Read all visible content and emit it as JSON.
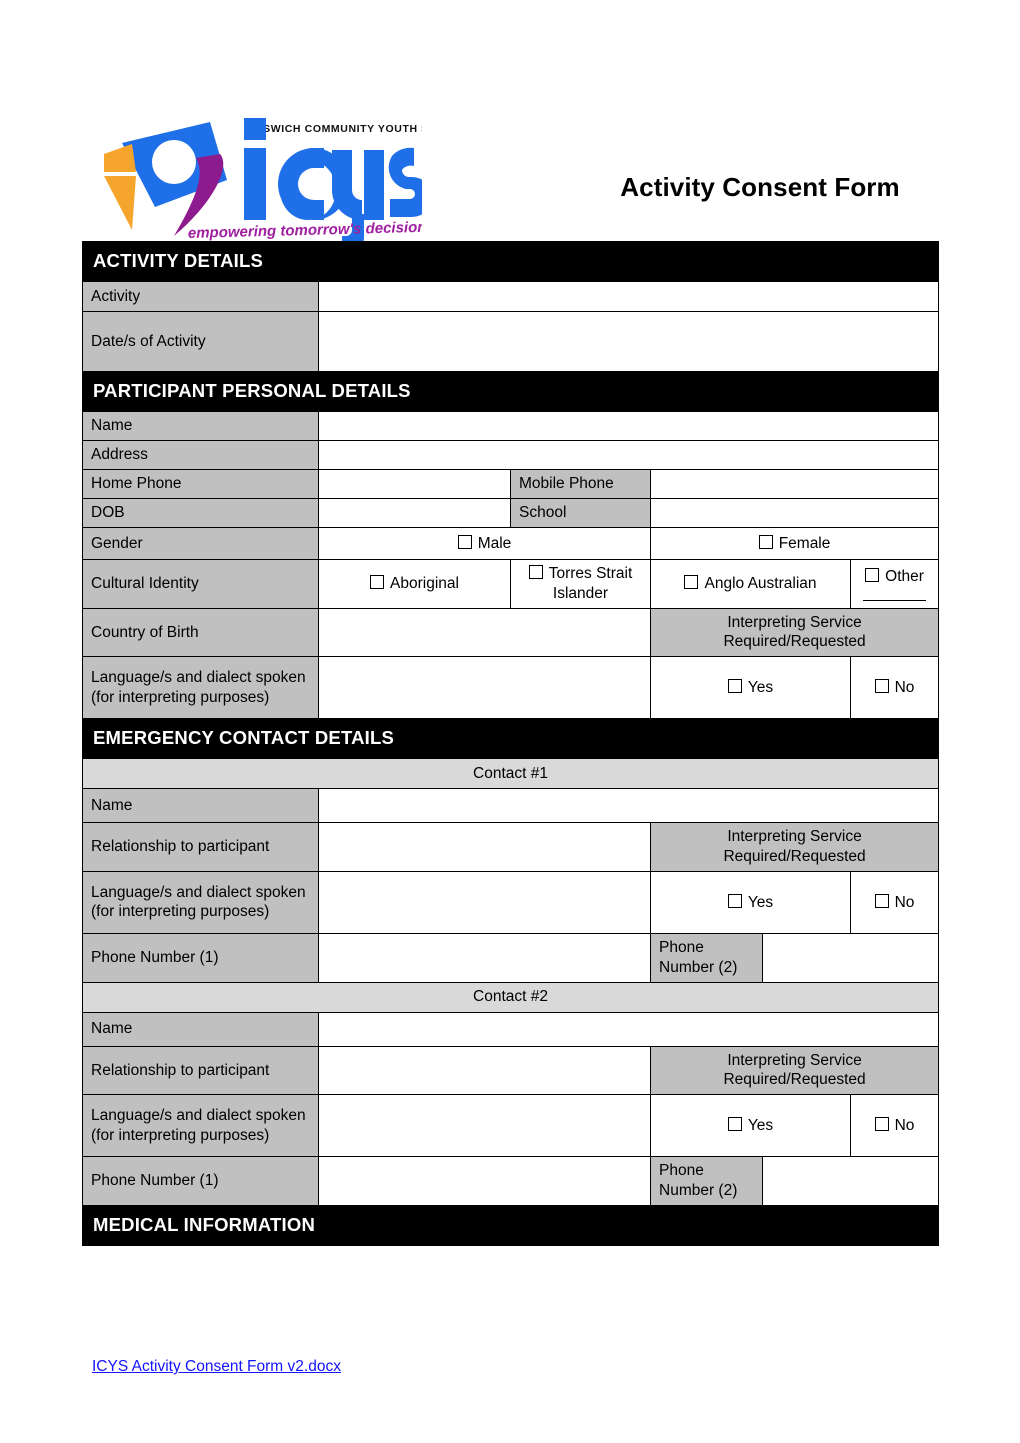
{
  "document": {
    "title": "Activity Consent Form",
    "logo": {
      "brand": "icus",
      "full_name": "IPSWICH COMMUNITY YOUTH SERVICE",
      "tagline": "empowering tomorrow's decisions",
      "colors": {
        "blue": "#1f6fe8",
        "orange": "#f5a52b",
        "purple": "#8d1b8d"
      }
    },
    "footer": "ICYS Activity Consent Form v2.docx",
    "footer_color": "#1414ff"
  },
  "colors": {
    "section_bar_bg": "#000000",
    "section_bar_text": "#ffffff",
    "label_bg": "#c0c0c0",
    "subhead_bg": "#d9d9d9",
    "field_bg": "#ffffff",
    "border": "#000000"
  },
  "sections": {
    "activity_details": {
      "heading": "ACTIVITY DETAILS",
      "rows": [
        {
          "label": "Activity",
          "value": ""
        },
        {
          "label": "Date/s of Activity",
          "value": ""
        }
      ]
    },
    "participant_personal_details": {
      "heading": "PARTICIPANT PERSONAL DETAILS",
      "name_label": "Name",
      "name_value": "",
      "address_label": "Address",
      "address_value": "",
      "home_phone_label": "Home Phone",
      "home_phone_value": "",
      "mobile_phone_label": "Mobile Phone",
      "mobile_phone_value": "",
      "dob_label": "DOB",
      "dob_value": "",
      "school_label": "School",
      "school_value": "",
      "gender_label": "Gender",
      "gender_options": [
        "Male",
        "Female"
      ],
      "cultural_identity_label": "Cultural Identity",
      "cultural_identity_options": [
        "Aboriginal",
        "Torres Strait Islander",
        "Anglo Australian",
        "Other"
      ],
      "country_of_birth_label": "Country of Birth",
      "country_of_birth_value": "",
      "interpreting_header": "Interpreting Service Required/Requested",
      "language_label": "Language/s and dialect spoken (for interpreting purposes)",
      "language_value": "",
      "interpreting_options": [
        "Yes",
        "No"
      ]
    },
    "emergency_contact_details": {
      "heading": "EMERGENCY CONTACT DETAILS",
      "contacts": [
        {
          "subheading": "Contact #1",
          "name_label": "Name",
          "name_value": "",
          "relationship_label": "Relationship to participant",
          "relationship_value": "",
          "interpreting_header": "Interpreting Service Required/Requested",
          "language_label": "Language/s and dialect spoken (for interpreting purposes)",
          "language_value": "",
          "interpreting_options": [
            "Yes",
            "No"
          ],
          "phone1_label": "Phone Number (1)",
          "phone1_value": "",
          "phone2_label": "Phone Number (2)",
          "phone2_value": ""
        },
        {
          "subheading": "Contact #2",
          "name_label": "Name",
          "name_value": "",
          "relationship_label": "Relationship to participant",
          "relationship_value": "",
          "interpreting_header": "Interpreting Service Required/Requested",
          "language_label": "Language/s and dialect spoken (for interpreting purposes)",
          "language_value": "",
          "interpreting_options": [
            "Yes",
            "No"
          ],
          "phone1_label": "Phone Number (1)",
          "phone1_value": "",
          "phone2_label": "Phone Number (2)",
          "phone2_value": ""
        }
      ]
    },
    "medical_information": {
      "heading": "MEDICAL INFORMATION"
    }
  }
}
